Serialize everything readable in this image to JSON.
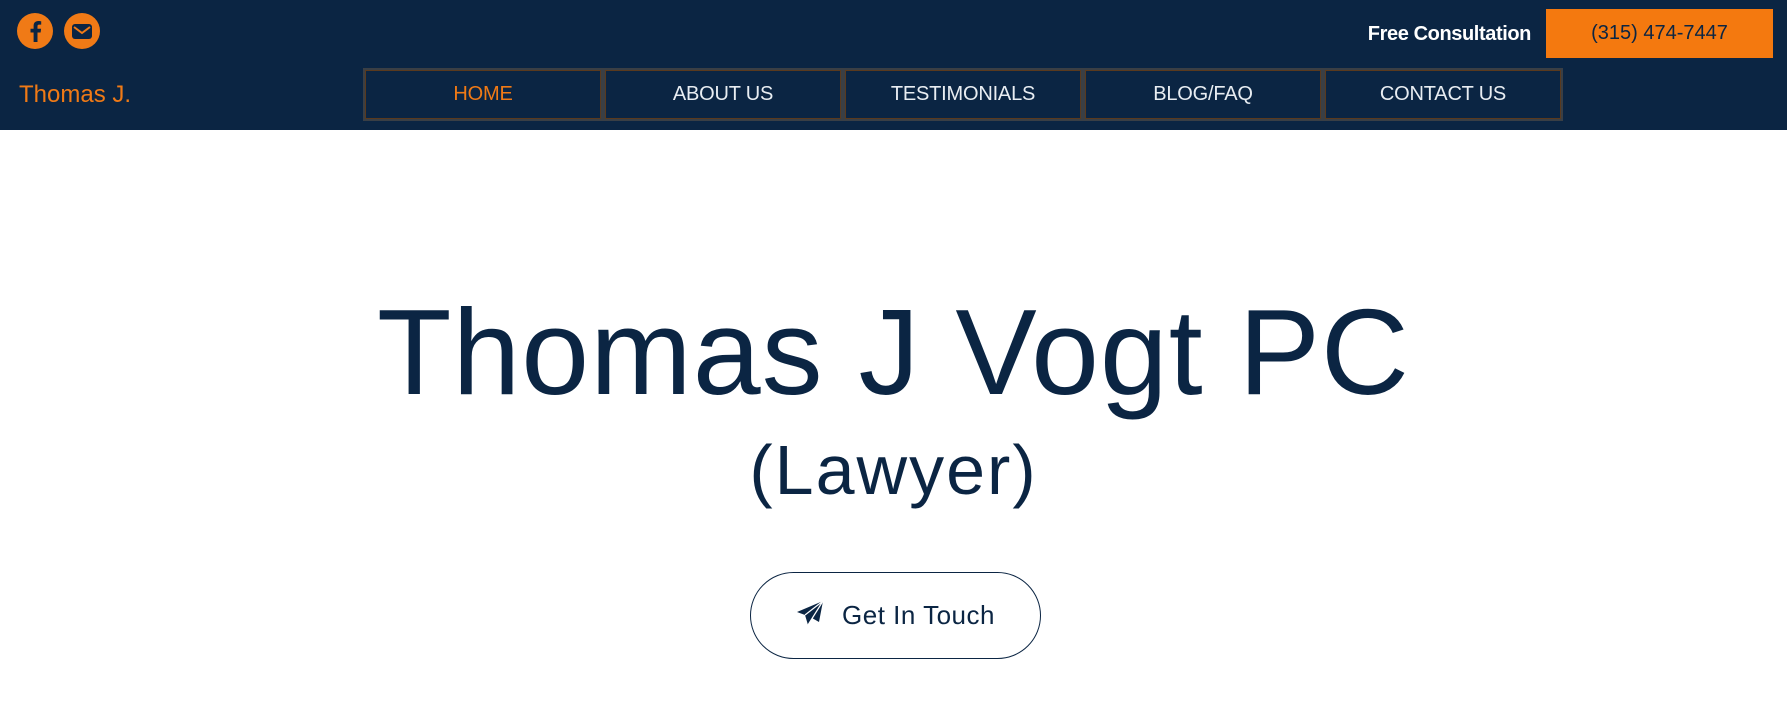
{
  "header": {
    "social": [
      {
        "icon": "facebook-icon"
      },
      {
        "icon": "envelope-icon"
      }
    ],
    "cta_label": "Free Consultation",
    "phone": "(315) 474-7447",
    "brand": "Thomas J."
  },
  "nav": {
    "items": [
      {
        "label": "HOME",
        "active": true
      },
      {
        "label": "ABOUT US"
      },
      {
        "label": "TESTIMONIALS"
      },
      {
        "label": "BLOG/FAQ"
      },
      {
        "label": "CONTACT US"
      }
    ]
  },
  "hero": {
    "title": "Thomas J Vogt PC",
    "subtitle": "(Lawyer)",
    "button_label": "Get In Touch",
    "button_icon": "paper-plane-icon"
  },
  "colors": {
    "header_bg": "#0b2543",
    "accent": "#f07a16",
    "text_dark": "#0b2543"
  }
}
